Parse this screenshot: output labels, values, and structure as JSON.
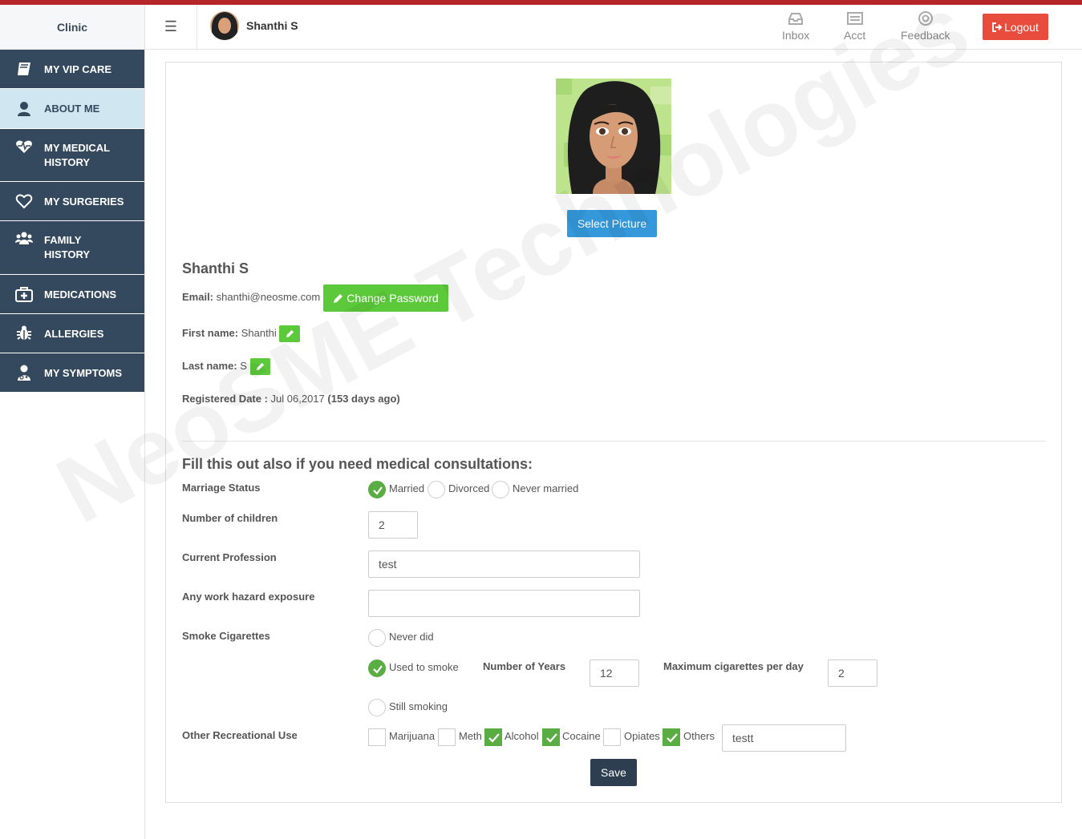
{
  "header": {
    "brand": "Clinic",
    "user_name": "Shanthi S",
    "nav": [
      {
        "label": "Inbox",
        "icon": "inbox-icon"
      },
      {
        "label": "Acct",
        "icon": "account-icon"
      },
      {
        "label": "Feedback",
        "icon": "lifebuoy-icon"
      }
    ],
    "logout_label": "Logout"
  },
  "sidebar": {
    "items": [
      {
        "label": "MY VIP CARE",
        "icon": "book-icon",
        "active": false
      },
      {
        "label": "ABOUT ME",
        "icon": "user-icon",
        "active": true
      },
      {
        "label": "MY MEDICAL HISTORY",
        "line1": "MY MEDICAL",
        "line2": "HISTORY",
        "icon": "heartbeat-icon",
        "active": false
      },
      {
        "label": "MY SURGERIES",
        "icon": "heart-icon",
        "active": false
      },
      {
        "label": "FAMILY HISTORY",
        "line1": "FAMILY",
        "line2": "HISTORY",
        "icon": "users-icon",
        "active": false
      },
      {
        "label": "MEDICATIONS",
        "icon": "medkit-icon",
        "active": false
      },
      {
        "label": "ALLERGIES",
        "icon": "bug-icon",
        "active": false
      },
      {
        "label": "MY SYMPTOMS",
        "icon": "user-md-icon",
        "active": false
      }
    ]
  },
  "profile": {
    "select_picture_label": "Select Picture",
    "full_name": "Shanthi S",
    "email_label": "Email:",
    "email": "shanthi@neosme.com",
    "change_password_label": "Change Password",
    "first_name_label": "First name:",
    "first_name": "Shanthi",
    "last_name_label": "Last name:",
    "last_name": "S",
    "registered_label": "Registered Date :",
    "registered_date": "Jul 06,2017",
    "registered_ago": "(153 days ago)"
  },
  "consult": {
    "heading": "Fill this out also if you need medical consultations:",
    "marriage_label": "Marriage Status",
    "marriage_options": [
      {
        "label": "Married",
        "checked": true
      },
      {
        "label": "Divorced",
        "checked": false
      },
      {
        "label": "Never married",
        "checked": false
      }
    ],
    "children_label": "Number of children",
    "children_value": "2",
    "profession_label": "Current Profession",
    "profession_value": "test",
    "hazard_label": "Any work hazard exposure",
    "hazard_value": "",
    "smoke_label": "Smoke Cigarettes",
    "smoke_options": [
      {
        "label": "Never did",
        "checked": false
      },
      {
        "label": "Used to smoke",
        "checked": true
      },
      {
        "label": "Still smoking",
        "checked": false
      }
    ],
    "years_label": "Number of Years",
    "years_value": "12",
    "max_cig_label": "Maximum cigarettes per day",
    "max_cig_value": "2",
    "recreational_label": "Other Recreational Use",
    "recreational_options": [
      {
        "label": "Marijuana",
        "checked": false
      },
      {
        "label": "Meth",
        "checked": false
      },
      {
        "label": "Alcohol",
        "checked": true
      },
      {
        "label": "Cocaine",
        "checked": true
      },
      {
        "label": "Opiates",
        "checked": false
      },
      {
        "label": "Others",
        "checked": true
      }
    ],
    "others_value": "testt",
    "save_label": "Save"
  },
  "watermark": "NeoSME Technologies",
  "colors": {
    "sidebar": "#34495e",
    "sidebar_active": "#d0e6f0",
    "logout": "#e74c3c",
    "select_picture": "#3498db",
    "green": "#5cc93a",
    "check": "#5aad43",
    "save": "#2c3e50",
    "top_stripe": "#b5252a"
  }
}
